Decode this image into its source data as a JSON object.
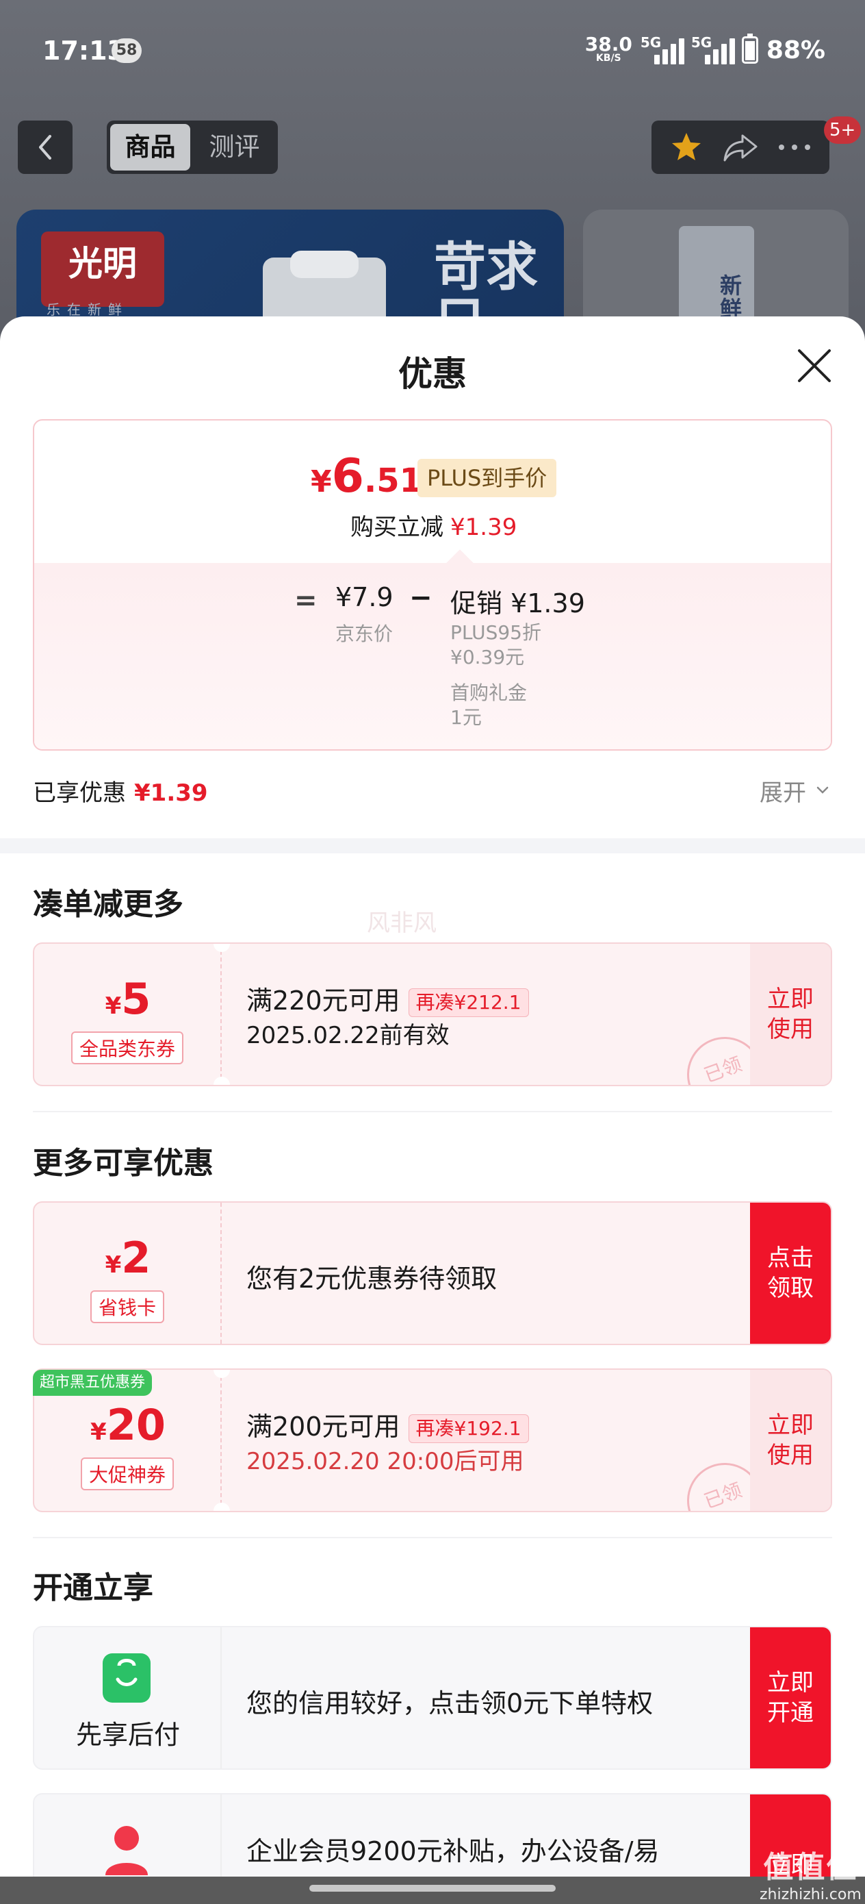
{
  "status_bar": {
    "time": "17:13",
    "notification_count": "58",
    "net_speed": "38.0",
    "net_speed_unit": "KB/S",
    "sim1": "5G",
    "sim2": "5G",
    "battery": "88%"
  },
  "nav": {
    "tabs": [
      {
        "label": "商品",
        "active": true
      },
      {
        "label": "测评",
        "active": false
      }
    ],
    "message_badge": "5+"
  },
  "product_gallery": {
    "brand_logo": "光明",
    "brand_slogan": "乐在新鲜",
    "banner_text": "苛求只",
    "side_box_text": "新鲜"
  },
  "sheet": {
    "title": "优惠",
    "price_summary": {
      "currency": "¥",
      "price_int": "6",
      "price_dec": ".51",
      "plus_label": "PLUS到手价",
      "instant_cut_label": "购买立减",
      "instant_cut_value": "¥1.39",
      "equals": "=",
      "jd_price": "¥7.9",
      "jd_price_label": "京东价",
      "minus": "−",
      "promo": "促销 ¥1.39",
      "promo_line1": "PLUS95折",
      "promo_line2": "¥0.39元",
      "promo_line3": "首购礼金",
      "promo_line4": "1元"
    },
    "saved_label": "已享优惠",
    "saved_value": "¥1.39",
    "expand_label": "展开",
    "sections": {
      "combine": {
        "title": "凑单减更多",
        "watermark": "风非风",
        "coupon": {
          "currency": "¥",
          "amount": "5",
          "tag": "全品类东券",
          "main": "满220元可用",
          "pill": "再凑¥212.1",
          "sub": "2025.02.22前有效",
          "button": "立即\n使用",
          "stamp": "已领"
        }
      },
      "more": {
        "title": "更多可享优惠",
        "coupons": [
          {
            "currency": "¥",
            "amount": "2",
            "tag": "省钱卡",
            "main": "您有2元优惠券待领取",
            "button": "点击\n领取"
          },
          {
            "corner_badge": "超市黑五优惠券",
            "currency": "¥",
            "amount": "20",
            "tag": "大促神券",
            "main": "满200元可用",
            "pill": "再凑¥192.1",
            "sub": "2025.02.20 20:00后可用",
            "button": "立即\n使用",
            "stamp": "已领"
          }
        ]
      },
      "open": {
        "title": "开通立享",
        "items": [
          {
            "label": "先享后付",
            "main": "您的信用较好，点击领0元下单特权",
            "button": "立即\n开通"
          },
          {
            "main": "企业会员9200元补贴，办公设备/易",
            "button": "立即"
          }
        ]
      }
    }
  },
  "watermark": {
    "logo": "值值值",
    "site": "zhizhizhi.com"
  },
  "colors": {
    "accent_red": "#e51c2a",
    "button_red": "#f0142a",
    "green_badge": "#3ec35c",
    "plus_gold_bg": "#fbe9c9"
  }
}
